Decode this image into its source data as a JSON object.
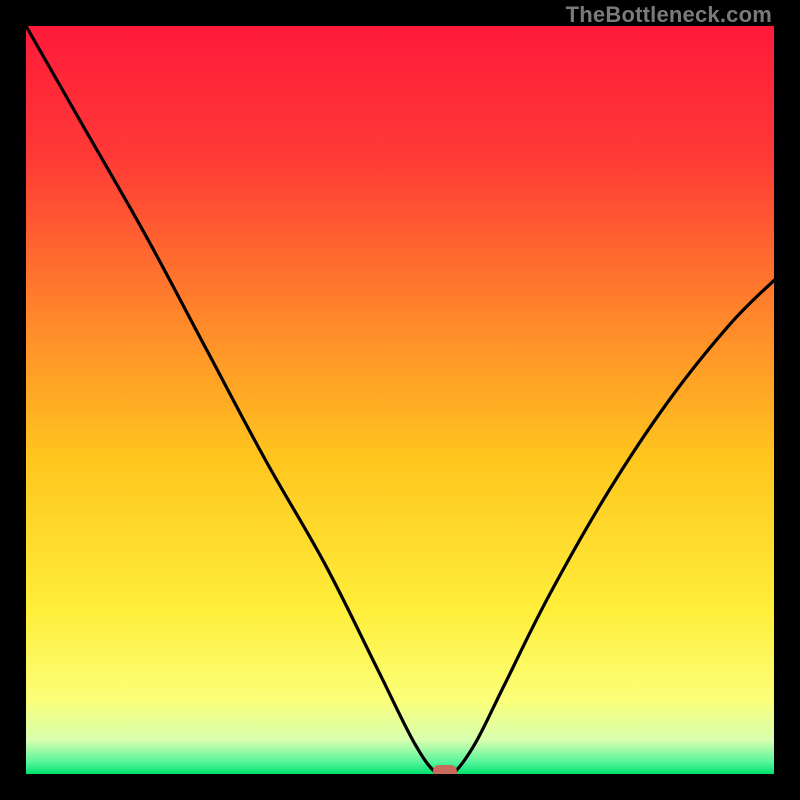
{
  "watermark": "TheBottleneck.com",
  "chart_data": {
    "type": "line",
    "title": "",
    "xlabel": "",
    "ylabel": "",
    "xlim": [
      0,
      100
    ],
    "ylim": [
      0,
      100
    ],
    "grid": false,
    "legend": false,
    "series": [
      {
        "name": "bottleneck-curve",
        "x": [
          0,
          8,
          16,
          24,
          32,
          40,
          47,
          52,
          55,
          57,
          60,
          64,
          70,
          78,
          86,
          94,
          100
        ],
        "values": [
          100,
          86,
          72,
          57,
          42,
          28,
          14,
          4,
          0,
          0,
          4,
          12,
          24,
          38,
          50,
          60,
          66
        ]
      }
    ],
    "marker": {
      "x": 56,
      "y": 0
    },
    "gradient_stops": [
      {
        "offset": 0.0,
        "color": "#ff1a3a"
      },
      {
        "offset": 0.18,
        "color": "#ff3b36"
      },
      {
        "offset": 0.4,
        "color": "#ff8a2a"
      },
      {
        "offset": 0.58,
        "color": "#ffc61e"
      },
      {
        "offset": 0.78,
        "color": "#ffee3a"
      },
      {
        "offset": 0.9,
        "color": "#fbff78"
      },
      {
        "offset": 0.955,
        "color": "#d8ffb0"
      },
      {
        "offset": 0.985,
        "color": "#51f59a"
      },
      {
        "offset": 1.0,
        "color": "#00e06a"
      }
    ]
  }
}
